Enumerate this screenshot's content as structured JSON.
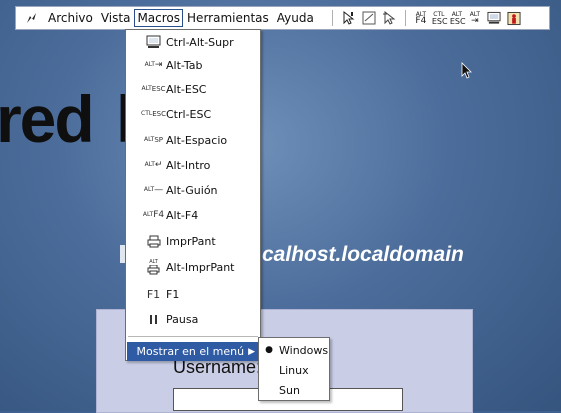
{
  "toolbar": {
    "menus": [
      "Archivo",
      "Vista",
      "Macros",
      "Herramientas",
      "Ayuda"
    ],
    "key_icons": [
      {
        "line1": "ALT",
        "line2": "F4"
      },
      {
        "line1": "CTL",
        "line2": "ESC"
      },
      {
        "line1": "ALT",
        "line2": "ESC"
      },
      {
        "line1": "ALT",
        "line2": "⇥"
      }
    ]
  },
  "background": {
    "brand_text": "red",
    "brand_tail": "h",
    "hostname": "calhost.localdomain",
    "username_label": "Username:"
  },
  "macros_menu": {
    "items": [
      {
        "label": "Ctrl-Alt-Supr",
        "icon": "keyboard-icon",
        "line1": "",
        "line2": ""
      },
      {
        "label": "Alt-Tab",
        "icon": "alt-tab-key-icon",
        "line1": "ALT",
        "line2": "⇥"
      },
      {
        "label": "Alt-ESC",
        "icon": "alt-esc-key-icon",
        "line1": "ALT",
        "line2": "ESC"
      },
      {
        "label": "Ctrl-ESC",
        "icon": "ctrl-esc-key-icon",
        "line1": "CTL",
        "line2": "ESC"
      },
      {
        "label": "Alt-Espacio",
        "icon": "alt-space-key-icon",
        "line1": "ALT",
        "line2": "SP"
      },
      {
        "label": "Alt-Intro",
        "icon": "alt-enter-key-icon",
        "line1": "ALT",
        "line2": "↵"
      },
      {
        "label": "Alt-Guión",
        "icon": "alt-hyphen-key-icon",
        "line1": "ALT",
        "line2": "—"
      },
      {
        "label": "Alt-F4",
        "icon": "alt-f4-key-icon",
        "line1": "ALT",
        "line2": "F4"
      },
      {
        "label": "ImprPant",
        "icon": "printer-icon",
        "line1": "",
        "line2": ""
      },
      {
        "label": "Alt-ImprPant",
        "icon": "alt-printer-icon",
        "line1": "ALT",
        "line2": ""
      },
      {
        "label": "F1",
        "icon": "f1-text-icon",
        "line1": "",
        "line2": ""
      },
      {
        "label": "Pausa",
        "icon": "pause-icon",
        "line1": "",
        "line2": ""
      }
    ],
    "show_in_menu_label": "Mostrar en el menú"
  },
  "submenu": {
    "items": [
      {
        "label": "Windows",
        "selected": true
      },
      {
        "label": "Linux",
        "selected": false
      },
      {
        "label": "Sun",
        "selected": false
      }
    ],
    "bullet": "●"
  },
  "colors": {
    "highlight": "#2f5aa4",
    "desktop": "#4c6d9b",
    "login_panel": "#c9cde6"
  }
}
